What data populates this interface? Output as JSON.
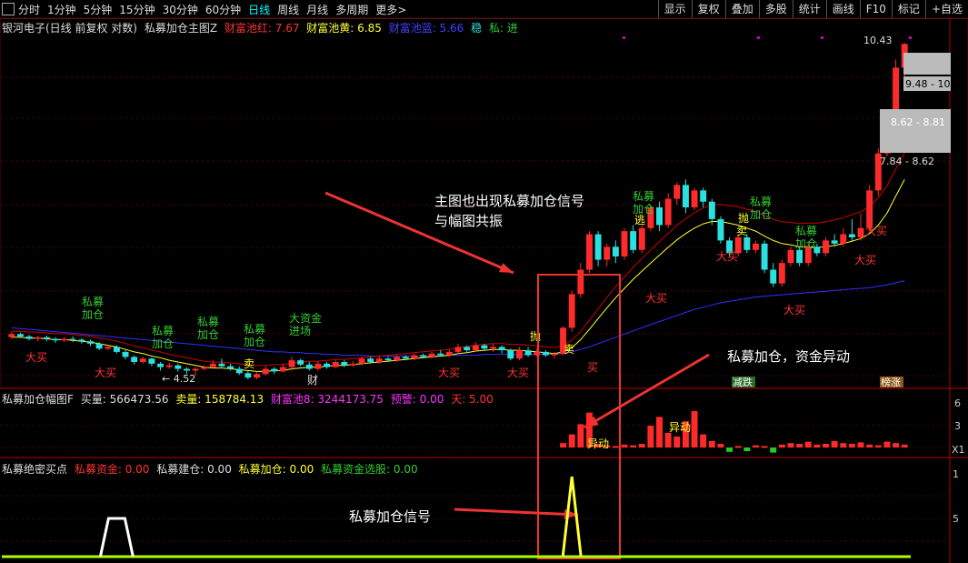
{
  "toolbar": {
    "periods": [
      "分时",
      "1分钟",
      "5分钟",
      "15分钟",
      "30分钟",
      "60分钟",
      "日线",
      "周线",
      "月线",
      "多周期",
      "更多>"
    ],
    "active_period": "日线",
    "tools": [
      "显示",
      "复权",
      "叠加",
      "多股",
      "统计",
      "画线",
      "F10",
      "标记",
      "+自选"
    ]
  },
  "main_panel": {
    "stock_label": "银河电子(日线 前复权 对数)",
    "indicator_name": "私募加仓主图Z",
    "red_pool_label": "财富池红: 7.67",
    "yellow_pool_label": "财富池黄: 6.85",
    "blue_pool_label": "财富池蓝: 5.66",
    "stable_label": "稳",
    "private_label": "私: 进",
    "price_labels": [
      "10.43",
      "9.48 - 10.",
      "8.62 - 8.81",
      "7.84 - 8.62",
      "4.52"
    ],
    "signals": {
      "private_add": "私募\n加仓",
      "big_fund": "大资金\n进场",
      "big_buy": "大买",
      "sell": "卖",
      "throw": "抛",
      "escape": "逃",
      "wealth": "财",
      "buy": "买"
    },
    "tags": {
      "fall": "减跌",
      "rise": "榜涨"
    },
    "annotation_main": "主图也出现私募加仓信号\n与幅图共振",
    "annotation_sub": "私募加仓，资金异动",
    "annotation_bottom": "私募加仓信号"
  },
  "sub_panel1": {
    "title": "私募加仓幅图F",
    "buy_label": "买量: 566473.56",
    "sell_label": "卖量: 158784.13",
    "pool_label": "财富池8: 3244173.75",
    "warn_label": "预警: 0.00",
    "day_label": "天: 5.00",
    "anomaly": "异动",
    "axis": [
      "6",
      "3",
      "X1"
    ]
  },
  "sub_panel2": {
    "title": "私募绝密买点",
    "fund_label": "私募资金: 0.00",
    "build_label": "私募建仓: 0.00",
    "add_label": "私募加仓: 0.00",
    "select_label": "私募资金选股: 0.00",
    "axis": [
      "1",
      "5"
    ]
  },
  "colors": {
    "up": "#ff2a2a",
    "down": "#2de0e0",
    "yellow": "#ffff33",
    "blue": "#3030ff",
    "green": "#33cc33",
    "pink": "#ff33ff"
  },
  "chart_data": {
    "type": "candlestick",
    "candles": [
      [
        4.98,
        5.02,
        4.96,
        5.05
      ],
      [
        5.02,
        4.99,
        4.97,
        5.04
      ],
      [
        4.99,
        4.96,
        4.94,
        5.01
      ],
      [
        4.96,
        4.98,
        4.93,
        5.0
      ],
      [
        4.98,
        4.96,
        4.93,
        5.0
      ],
      [
        4.96,
        4.94,
        4.91,
        4.98
      ],
      [
        4.94,
        4.96,
        4.92,
        4.98
      ],
      [
        4.96,
        4.95,
        4.92,
        4.99
      ],
      [
        4.95,
        4.93,
        4.9,
        4.97
      ],
      [
        4.93,
        4.9,
        4.87,
        4.95
      ],
      [
        4.9,
        4.84,
        4.82,
        4.92
      ],
      [
        4.84,
        4.86,
        4.82,
        4.89
      ],
      [
        4.86,
        4.8,
        4.78,
        4.88
      ],
      [
        4.8,
        4.74,
        4.71,
        4.82
      ],
      [
        4.74,
        4.68,
        4.65,
        4.76
      ],
      [
        4.68,
        4.72,
        4.66,
        4.74
      ],
      [
        4.72,
        4.66,
        4.63,
        4.73
      ],
      [
        4.66,
        4.62,
        4.58,
        4.68
      ],
      [
        4.62,
        4.64,
        4.6,
        4.67
      ],
      [
        4.64,
        4.6,
        4.57,
        4.66
      ],
      [
        4.6,
        4.58,
        4.54,
        4.62
      ],
      [
        4.58,
        4.6,
        4.52,
        4.62
      ],
      [
        4.6,
        4.62,
        4.58,
        4.64
      ],
      [
        4.62,
        4.66,
        4.6,
        4.7
      ],
      [
        4.66,
        4.63,
        4.61,
        4.72
      ],
      [
        4.63,
        4.6,
        4.58,
        4.66
      ],
      [
        4.6,
        4.55,
        4.53,
        4.63
      ],
      [
        4.55,
        4.5,
        4.48,
        4.58
      ],
      [
        4.5,
        4.54,
        4.48,
        4.57
      ],
      [
        4.54,
        4.6,
        4.52,
        4.63
      ],
      [
        4.6,
        4.57,
        4.54,
        4.62
      ],
      [
        4.57,
        4.62,
        4.56,
        4.66
      ],
      [
        4.62,
        4.7,
        4.58,
        4.74
      ],
      [
        4.7,
        4.65,
        4.63,
        4.72
      ],
      [
        4.65,
        4.6,
        4.58,
        4.68
      ],
      [
        4.6,
        4.66,
        4.58,
        4.69
      ],
      [
        4.66,
        4.62,
        4.6,
        4.68
      ],
      [
        4.62,
        4.68,
        4.61,
        4.7
      ],
      [
        4.68,
        4.64,
        4.62,
        4.7
      ],
      [
        4.64,
        4.66,
        4.62,
        4.69
      ],
      [
        4.66,
        4.72,
        4.64,
        4.74
      ],
      [
        4.72,
        4.68,
        4.66,
        4.74
      ],
      [
        4.68,
        4.72,
        4.66,
        4.75
      ],
      [
        4.72,
        4.7,
        4.68,
        4.74
      ],
      [
        4.7,
        4.74,
        4.68,
        4.76
      ],
      [
        4.74,
        4.72,
        4.7,
        4.76
      ],
      [
        4.72,
        4.76,
        4.7,
        4.78
      ],
      [
        4.76,
        4.74,
        4.72,
        4.78
      ],
      [
        4.74,
        4.78,
        4.72,
        4.8
      ],
      [
        4.78,
        4.76,
        4.74,
        4.82
      ],
      [
        4.76,
        4.8,
        4.74,
        4.83
      ],
      [
        4.8,
        4.86,
        4.78,
        4.9
      ],
      [
        4.86,
        4.82,
        4.8,
        4.88
      ],
      [
        4.82,
        4.88,
        4.8,
        4.92
      ],
      [
        4.88,
        4.84,
        4.82,
        4.9
      ],
      [
        4.84,
        4.86,
        4.8,
        4.9
      ],
      [
        4.86,
        4.82,
        4.78,
        4.88
      ],
      [
        4.82,
        4.72,
        4.7,
        4.84
      ],
      [
        4.72,
        4.82,
        4.7,
        4.86
      ],
      [
        4.82,
        4.76,
        4.74,
        4.86
      ],
      [
        4.76,
        4.8,
        4.74,
        4.84
      ],
      [
        4.8,
        4.76,
        4.74,
        4.82
      ],
      [
        4.76,
        4.78,
        4.72,
        4.8
      ],
      [
        4.78,
        5.1,
        4.76,
        5.12
      ],
      [
        5.1,
        5.55,
        5.05,
        5.6
      ],
      [
        5.55,
        5.9,
        5.5,
        6.0
      ],
      [
        5.9,
        6.45,
        5.85,
        6.5
      ],
      [
        6.45,
        6.05,
        5.95,
        6.5
      ],
      [
        6.05,
        6.25,
        5.95,
        6.3
      ],
      [
        6.25,
        6.1,
        6.0,
        6.35
      ],
      [
        6.1,
        6.5,
        6.05,
        6.55
      ],
      [
        6.5,
        6.2,
        6.15,
        6.6
      ],
      [
        6.2,
        6.55,
        6.15,
        6.6
      ],
      [
        6.55,
        6.9,
        6.5,
        6.95
      ],
      [
        6.9,
        6.6,
        6.5,
        7.0
      ],
      [
        6.6,
        7.05,
        6.55,
        7.15
      ],
      [
        7.05,
        7.3,
        6.95,
        7.35
      ],
      [
        7.3,
        6.9,
        6.8,
        7.4
      ],
      [
        6.9,
        7.2,
        6.85,
        7.25
      ],
      [
        7.2,
        7.0,
        6.9,
        7.25
      ],
      [
        7.0,
        6.7,
        6.6,
        7.05
      ],
      [
        6.7,
        6.35,
        6.3,
        6.75
      ],
      [
        6.35,
        6.15,
        6.1,
        6.4
      ],
      [
        6.15,
        6.4,
        6.1,
        6.45
      ],
      [
        6.4,
        6.2,
        6.15,
        6.45
      ],
      [
        6.2,
        6.3,
        6.15,
        6.35
      ],
      [
        6.3,
        5.9,
        5.85,
        6.35
      ],
      [
        5.9,
        5.7,
        5.65,
        6.0
      ],
      [
        5.7,
        6.0,
        5.65,
        6.05
      ],
      [
        6.0,
        6.2,
        5.95,
        6.25
      ],
      [
        6.2,
        6.0,
        5.95,
        6.25
      ],
      [
        6.0,
        6.25,
        5.95,
        6.3
      ],
      [
        6.25,
        6.15,
        6.1,
        6.3
      ],
      [
        6.15,
        6.35,
        6.1,
        6.4
      ],
      [
        6.35,
        6.3,
        6.25,
        6.45
      ],
      [
        6.3,
        6.45,
        6.25,
        6.55
      ],
      [
        6.45,
        6.4,
        6.35,
        6.7
      ],
      [
        6.4,
        6.55,
        6.35,
        6.8
      ],
      [
        6.55,
        7.2,
        6.5,
        7.3
      ],
      [
        7.2,
        7.9,
        7.1,
        8.0
      ],
      [
        7.9,
        8.7,
        7.84,
        8.81
      ],
      [
        8.7,
        9.8,
        8.62,
        10.0
      ],
      [
        9.8,
        10.4,
        9.48,
        10.43
      ]
    ],
    "ma_yellow": [
      4.98,
      4.98,
      4.97,
      4.97,
      4.96,
      4.95,
      4.95,
      4.94,
      4.93,
      4.92,
      4.9,
      4.88,
      4.86,
      4.83,
      4.8,
      4.78,
      4.75,
      4.73,
      4.7,
      4.68,
      4.66,
      4.64,
      4.62,
      4.61,
      4.61,
      4.6,
      4.59,
      4.58,
      4.57,
      4.57,
      4.58,
      4.58,
      4.6,
      4.61,
      4.62,
      4.62,
      4.63,
      4.64,
      4.64,
      4.65,
      4.66,
      4.67,
      4.68,
      4.69,
      4.7,
      4.71,
      4.72,
      4.73,
      4.74,
      4.75,
      4.76,
      4.78,
      4.79,
      4.81,
      4.82,
      4.83,
      4.83,
      4.82,
      4.82,
      4.81,
      4.8,
      4.79,
      4.78,
      4.8,
      4.85,
      4.95,
      5.08,
      5.22,
      5.36,
      5.5,
      5.63,
      5.76,
      5.88,
      6.0,
      6.12,
      6.24,
      6.36,
      6.46,
      6.55,
      6.62,
      6.66,
      6.66,
      6.63,
      6.6,
      6.55,
      6.5,
      6.42,
      6.35,
      6.3,
      6.28,
      6.25,
      6.25,
      6.24,
      6.25,
      6.27,
      6.3,
      6.34,
      6.38,
      6.46,
      6.6,
      6.8,
      7.1,
      7.4
    ],
    "ma_blue": [
      5.1,
      5.09,
      5.08,
      5.07,
      5.06,
      5.05,
      5.04,
      5.03,
      5.02,
      5.01,
      5.0,
      4.99,
      4.98,
      4.97,
      4.96,
      4.95,
      4.94,
      4.93,
      4.92,
      4.91,
      4.9,
      4.89,
      4.88,
      4.87,
      4.86,
      4.85,
      4.84,
      4.83,
      4.82,
      4.81,
      4.8,
      4.8,
      4.79,
      4.79,
      4.78,
      4.78,
      4.77,
      4.77,
      4.76,
      4.76,
      4.76,
      4.75,
      4.75,
      4.75,
      4.75,
      4.75,
      4.75,
      4.75,
      4.75,
      4.75,
      4.76,
      4.76,
      4.76,
      4.76,
      4.77,
      4.77,
      4.77,
      4.77,
      4.77,
      4.77,
      4.77,
      4.77,
      4.77,
      4.78,
      4.8,
      4.83,
      4.86,
      4.9,
      4.94,
      4.98,
      5.02,
      5.06,
      5.1,
      5.14,
      5.18,
      5.22,
      5.26,
      5.3,
      5.34,
      5.37,
      5.4,
      5.43,
      5.45,
      5.47,
      5.49,
      5.51,
      5.52,
      5.53,
      5.54,
      5.55,
      5.56,
      5.57,
      5.58,
      5.59,
      5.6,
      5.61,
      5.62,
      5.63,
      5.64,
      5.66,
      5.68,
      5.71,
      5.74
    ],
    "sub1_bars": [
      0,
      0,
      0,
      0,
      0,
      0,
      0,
      0,
      0,
      0,
      0,
      0,
      0,
      0,
      0,
      0,
      0,
      0,
      0,
      0,
      0,
      0,
      0,
      0,
      0,
      0,
      0,
      0,
      0,
      0,
      0,
      0,
      0,
      0,
      0,
      0,
      0,
      0,
      0,
      0,
      0,
      0,
      0,
      0,
      0,
      0,
      0,
      0,
      0,
      0,
      0,
      0,
      0,
      0,
      0,
      0,
      0,
      0,
      0,
      0,
      0,
      0,
      0,
      0.6,
      1.8,
      3.2,
      4.8,
      0.5,
      0.3,
      0.2,
      0.4,
      0.3,
      0.5,
      3.0,
      4.2,
      2.0,
      1.5,
      3.6,
      5.0,
      1.8,
      0.9,
      0.5,
      -0.6,
      0.2,
      -0.5,
      0.3,
      0.2,
      -0.7,
      0.4,
      0.6,
      0.5,
      0.8,
      0.4,
      0.5,
      0.9,
      0.6,
      0.5,
      0.7,
      0.4,
      0.3,
      0.8,
      0.6,
      0.4
    ],
    "sub2_values": [
      0,
      0,
      0,
      0,
      0,
      0,
      0,
      0,
      0,
      0,
      0,
      1,
      1,
      1,
      0,
      0,
      0,
      0,
      0,
      0,
      0,
      0,
      0,
      0,
      0,
      0,
      0,
      0,
      0,
      0,
      0,
      0,
      0,
      0,
      0,
      0,
      0,
      0,
      0,
      0,
      0,
      0,
      0,
      0,
      0,
      0,
      0,
      0,
      0,
      0,
      0,
      0,
      0,
      0,
      0,
      0,
      0,
      0,
      0,
      0,
      0,
      0,
      0,
      0,
      1,
      0,
      0,
      0,
      0,
      0,
      0,
      0,
      0,
      0,
      0,
      0,
      0,
      0,
      0,
      0,
      0,
      0,
      0,
      0,
      0,
      0,
      0,
      0,
      0,
      0,
      0,
      0,
      0,
      0,
      0,
      0,
      0,
      0,
      0,
      0,
      0,
      0,
      0
    ]
  }
}
